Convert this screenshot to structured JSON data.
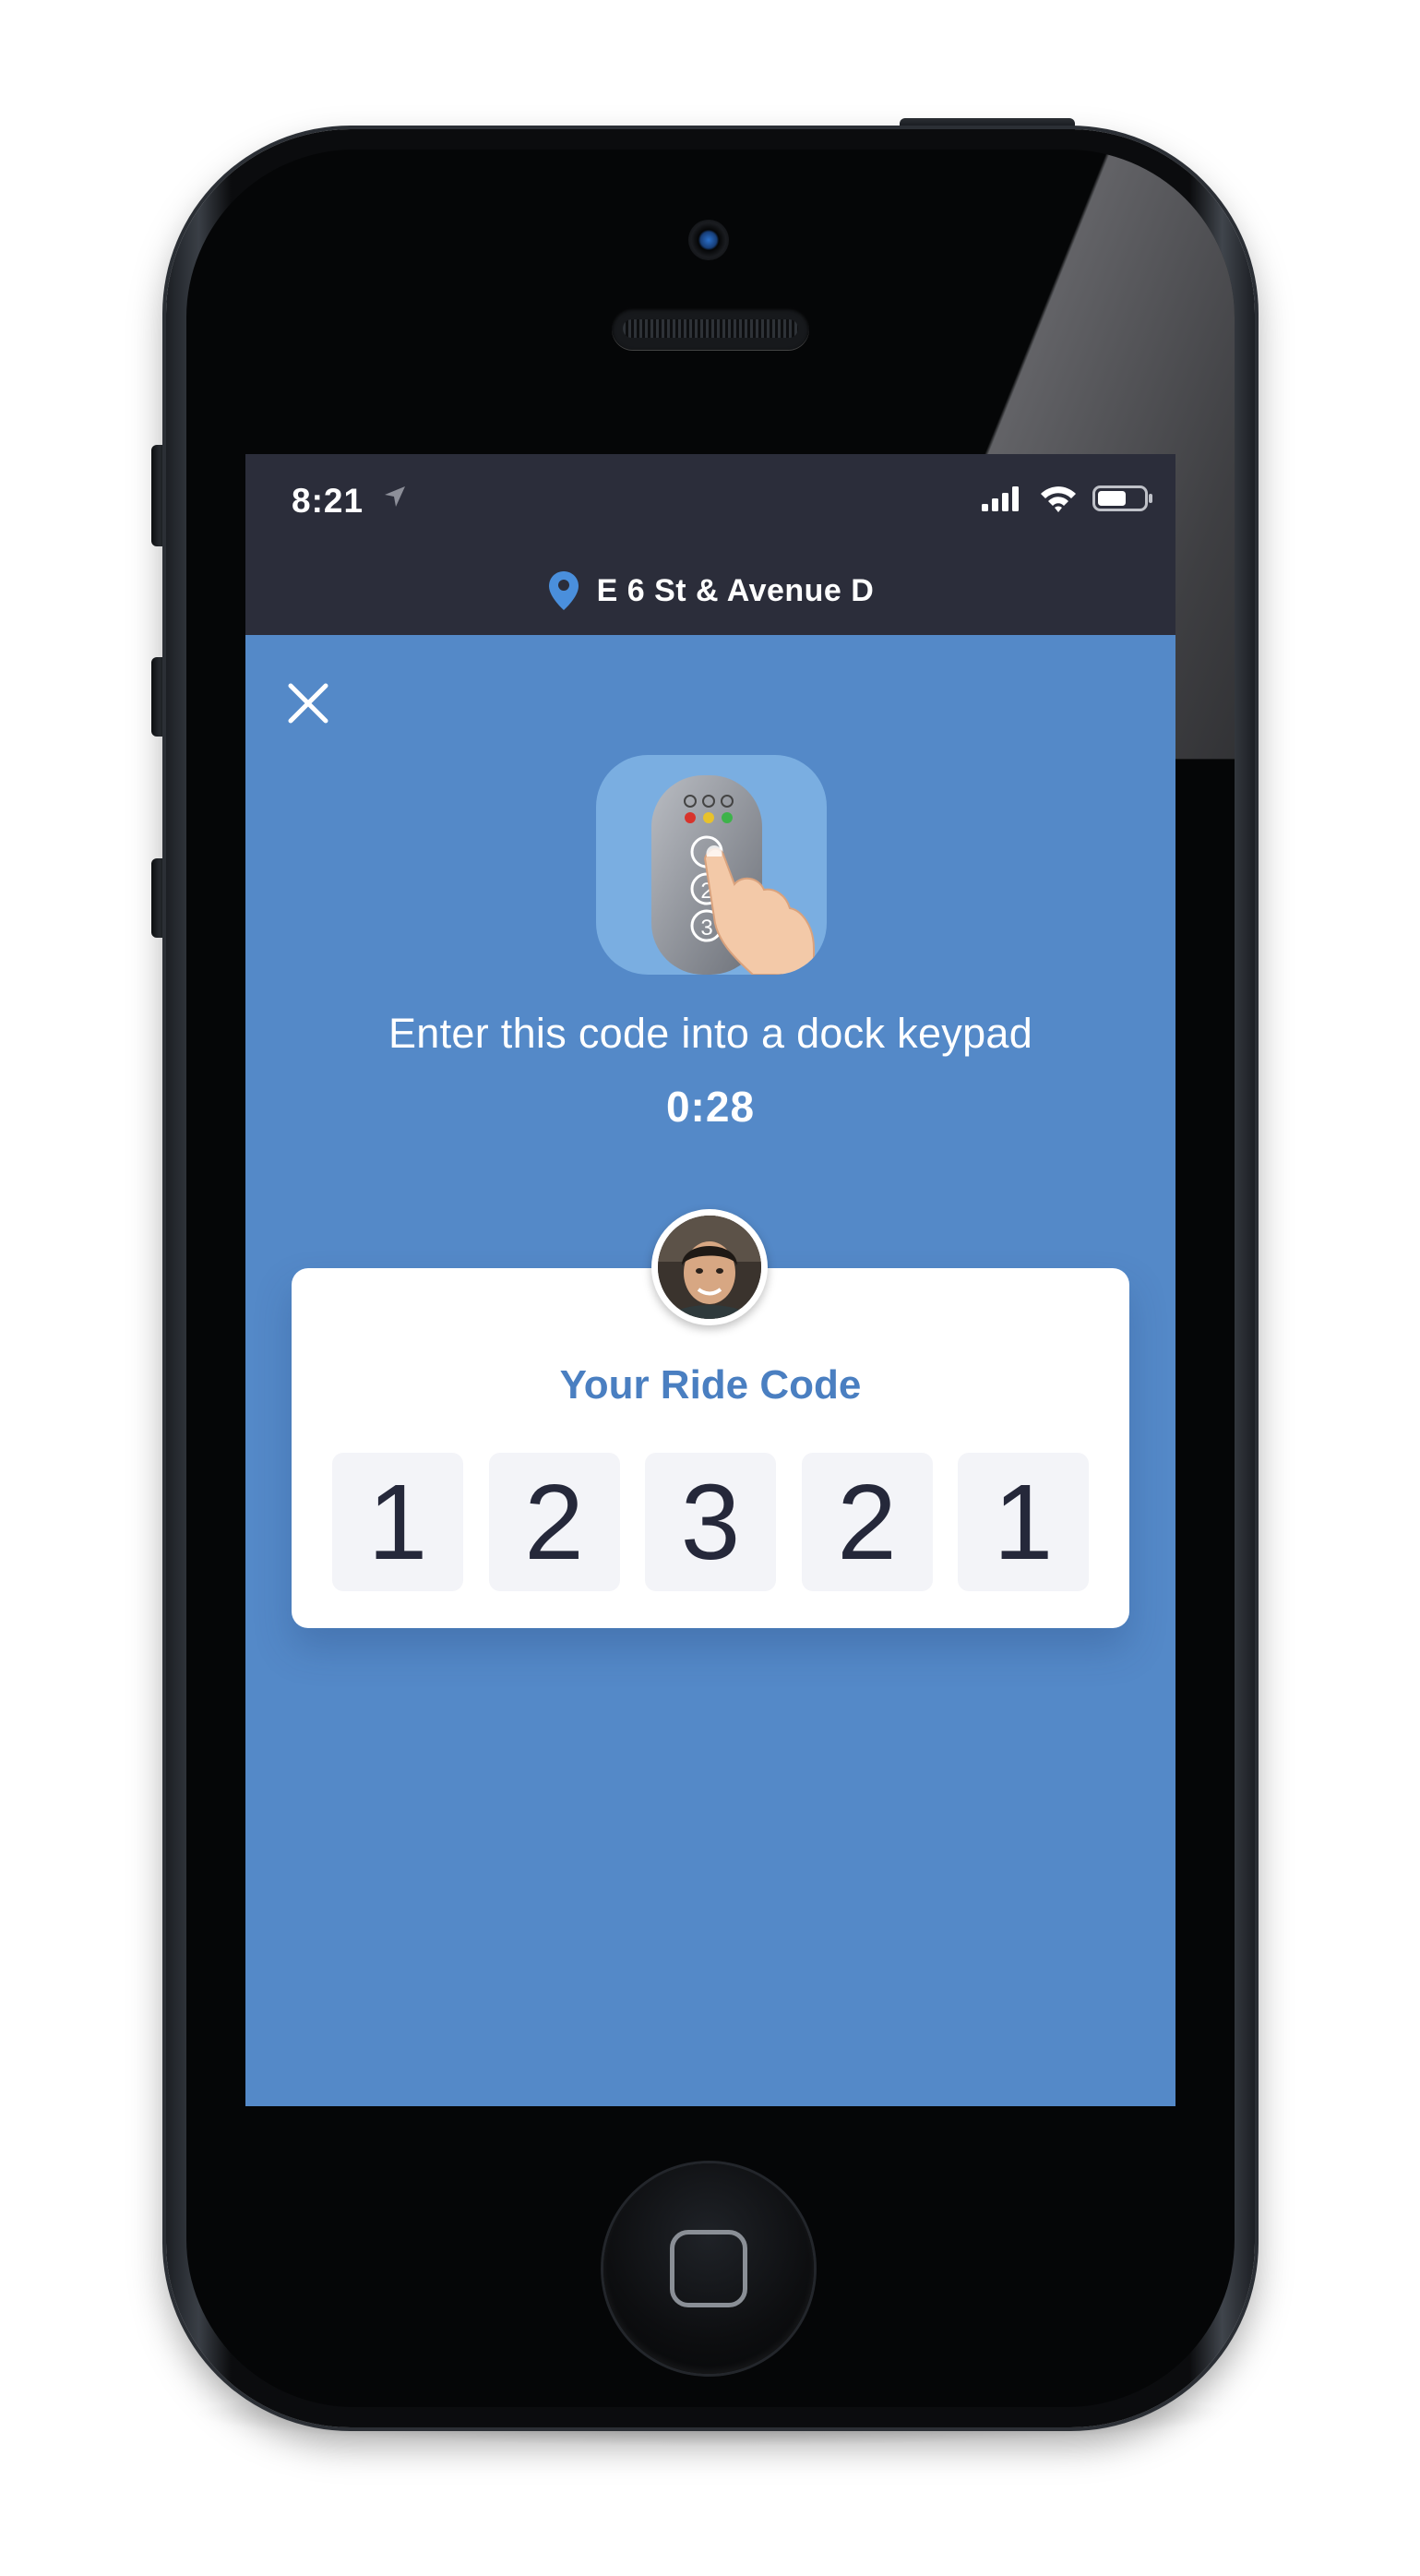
{
  "status_bar": {
    "time": "8:21"
  },
  "header": {
    "location_name": "E 6 St & Avenue D"
  },
  "main": {
    "instruction": "Enter this code into a dock keypad",
    "countdown": "0:28"
  },
  "ride_code_card": {
    "title": "Your Ride Code",
    "digits": [
      "1",
      "2",
      "3",
      "2",
      "1"
    ]
  },
  "colors": {
    "screen_background": "#5489c8",
    "header_background": "#2b2d3a",
    "card_title": "#4a7fc1",
    "digit_text": "#25283a",
    "digit_box": "#f3f4f8"
  },
  "icons": {
    "location": "location-pin-icon",
    "close": "close-icon",
    "illustration": "keypad-hand-illustration",
    "signal": "cellular-signal-icon",
    "wifi": "wifi-icon",
    "battery": "battery-icon",
    "navigation": "location-arrow-icon"
  }
}
